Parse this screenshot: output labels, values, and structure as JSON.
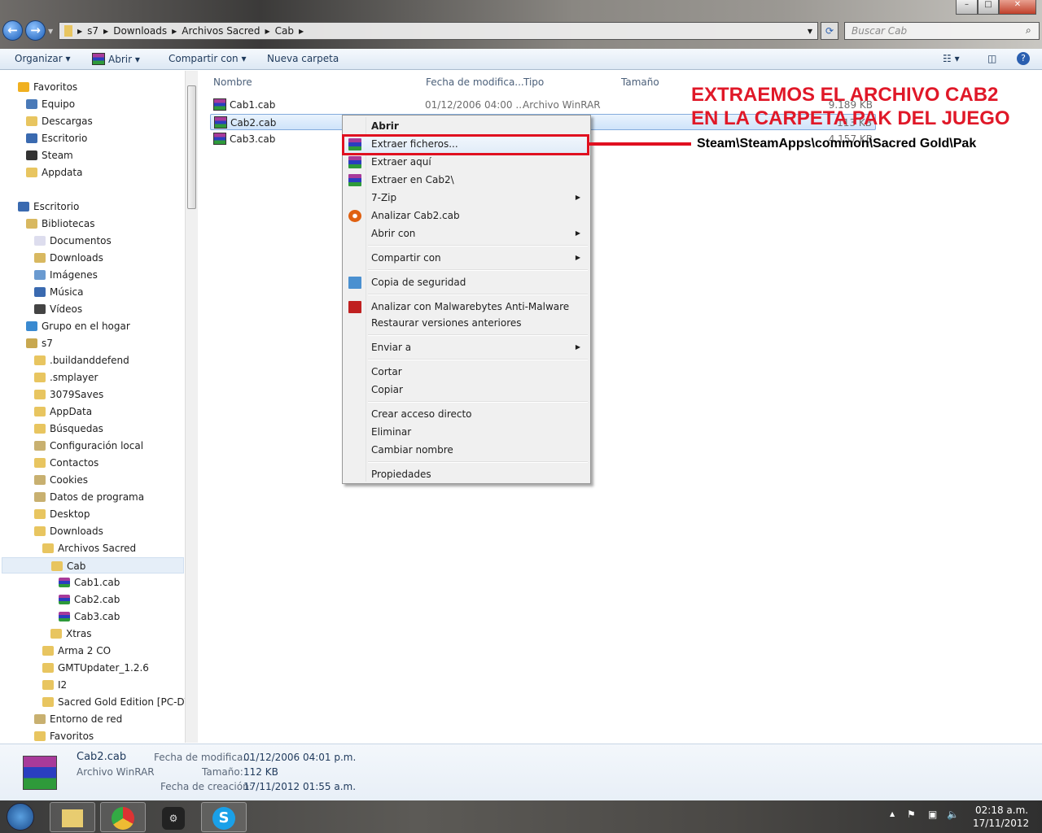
{
  "address": {
    "crumbs": [
      "s7",
      "Downloads",
      "Archivos Sacred",
      "Cab"
    ],
    "search_placeholder": "Buscar Cab"
  },
  "toolbar": {
    "organize": "Organizar",
    "open": "Abrir",
    "share": "Compartir con",
    "new_folder": "Nueva carpeta"
  },
  "sidebar": {
    "items": [
      {
        "label": "Favoritos",
        "level": 0,
        "icon": "star-icon"
      },
      {
        "label": "Equipo",
        "level": 1,
        "icon": "computer-icon"
      },
      {
        "label": "Descargas",
        "level": 1,
        "icon": "folder-icon"
      },
      {
        "label": "Escritorio",
        "level": 1,
        "icon": "desktop-icon"
      },
      {
        "label": "Steam",
        "level": 1,
        "icon": "steam-icon"
      },
      {
        "label": "Appdata",
        "level": 1,
        "icon": "folder-icon"
      },
      {
        "label": "Escritorio",
        "level": 0,
        "icon": "desktop-icon",
        "gap": true
      },
      {
        "label": "Bibliotecas",
        "level": 1,
        "icon": "library-icon"
      },
      {
        "label": "Documentos",
        "level": 2,
        "icon": "document-icon"
      },
      {
        "label": "Downloads",
        "level": 2,
        "icon": "library-icon"
      },
      {
        "label": "Imágenes",
        "level": 2,
        "icon": "image-icon"
      },
      {
        "label": "Música",
        "level": 2,
        "icon": "music-icon"
      },
      {
        "label": "Vídeos",
        "level": 2,
        "icon": "video-icon"
      },
      {
        "label": "Grupo en el hogar",
        "level": 1,
        "icon": "homegroup-icon"
      },
      {
        "label": "s7",
        "level": 1,
        "icon": "user-folder-icon"
      },
      {
        "label": ".buildanddefend",
        "level": 2,
        "icon": "folder-icon"
      },
      {
        "label": ".smplayer",
        "level": 2,
        "icon": "folder-icon"
      },
      {
        "label": "3079Saves",
        "level": 2,
        "icon": "folder-icon"
      },
      {
        "label": "AppData",
        "level": 2,
        "icon": "folder-icon"
      },
      {
        "label": "Búsquedas",
        "level": 2,
        "icon": "folder-icon"
      },
      {
        "label": "Configuración local",
        "level": 2,
        "icon": "shortcut-folder-icon"
      },
      {
        "label": "Contactos",
        "level": 2,
        "icon": "folder-icon"
      },
      {
        "label": "Cookies",
        "level": 2,
        "icon": "shortcut-folder-icon"
      },
      {
        "label": "Datos de programa",
        "level": 2,
        "icon": "shortcut-folder-icon"
      },
      {
        "label": "Desktop",
        "level": 2,
        "icon": "folder-icon"
      },
      {
        "label": "Downloads",
        "level": 2,
        "icon": "folder-icon"
      },
      {
        "label": "Archivos Sacred",
        "level": 3,
        "icon": "folder-icon"
      },
      {
        "label": "Cab",
        "level": 4,
        "icon": "folder-icon",
        "selected": true
      },
      {
        "label": "Cab1.cab",
        "level": 5,
        "icon": "winrar-icon"
      },
      {
        "label": "Cab2.cab",
        "level": 5,
        "icon": "winrar-icon"
      },
      {
        "label": "Cab3.cab",
        "level": 5,
        "icon": "winrar-icon"
      },
      {
        "label": "Xtras",
        "level": 4,
        "icon": "folder-icon"
      },
      {
        "label": "Arma 2 CO",
        "level": 3,
        "icon": "folder-icon"
      },
      {
        "label": "GMTUpdater_1.2.6",
        "level": 3,
        "icon": "folder-icon"
      },
      {
        "label": "I2",
        "level": 3,
        "icon": "folder-icon"
      },
      {
        "label": "Sacred Gold Edition [PC-DVD",
        "level": 3,
        "icon": "folder-icon"
      },
      {
        "label": "Entorno de red",
        "level": 2,
        "icon": "shortcut-folder-icon"
      },
      {
        "label": "Favoritos",
        "level": 2,
        "icon": "folder-icon"
      }
    ]
  },
  "columns": {
    "name": "Nombre",
    "date": "Fecha de modifica...",
    "type": "Tipo",
    "size": "Tamaño"
  },
  "files": [
    {
      "name": "Cab1.cab",
      "date": "01/12/2006 04:00 ...",
      "type": "Archivo WinRAR",
      "size": "9.189 KB"
    },
    {
      "name": "Cab2.cab",
      "date": "",
      "type": "",
      "size": "113 KB",
      "selected": true
    },
    {
      "name": "Cab3.cab",
      "date": "",
      "type": "",
      "size": "4.157 KB"
    }
  ],
  "context_menu": {
    "items": [
      {
        "label": "Abrir",
        "bold": true
      },
      {
        "label": "Extraer ficheros...",
        "icon": "winrar-icon",
        "highlighted": true
      },
      {
        "label": "Extraer aquí",
        "icon": "winrar-icon"
      },
      {
        "label": "Extraer en Cab2\\",
        "icon": "winrar-icon"
      },
      {
        "label": "7-Zip",
        "submenu": true
      },
      {
        "label": "Analizar Cab2.cab",
        "icon": "antivirus-icon"
      },
      {
        "label": "Abrir con",
        "submenu": true,
        "sep_after": true
      },
      {
        "label": "Compartir con",
        "submenu": true,
        "sep_after": true
      },
      {
        "label": "Copia de seguridad",
        "icon": "backup-icon",
        "sep_after": true
      },
      {
        "label": "Analizar con Malwarebytes Anti-Malware",
        "icon": "malwarebytes-icon",
        "tight": true
      },
      {
        "label": "Restaurar versiones anteriores",
        "sep_after": true
      },
      {
        "label": "Enviar a",
        "submenu": true,
        "sep_after": true
      },
      {
        "label": "Cortar"
      },
      {
        "label": "Copiar",
        "sep_after": true
      },
      {
        "label": "Crear acceso directo"
      },
      {
        "label": "Eliminar"
      },
      {
        "label": "Cambiar nombre",
        "sep_after": true
      },
      {
        "label": "Propiedades"
      }
    ]
  },
  "annotation": {
    "line1": "EXTRAEMOS EL ARCHIVO CAB2",
    "line2": "EN LA CARPETA PAK DEL JUEGO",
    "path": "Steam\\SteamApps\\common\\Sacred Gold\\Pak",
    "color": "#e01828"
  },
  "details": {
    "name": "Cab2.cab",
    "type": "Archivo WinRAR",
    "modified_label": "Fecha de modifica...",
    "modified": "01/12/2006 04:01 p.m.",
    "size_label": "Tamaño:",
    "size": "112 KB",
    "created_label": "Fecha de creación:",
    "created": "17/11/2012 01:55 a.m."
  },
  "taskbar": {
    "time": "02:18 a.m.",
    "date": "17/11/2012",
    "apps": [
      "explorer-icon",
      "chrome-icon",
      "steam-icon",
      "skype-icon"
    ]
  }
}
